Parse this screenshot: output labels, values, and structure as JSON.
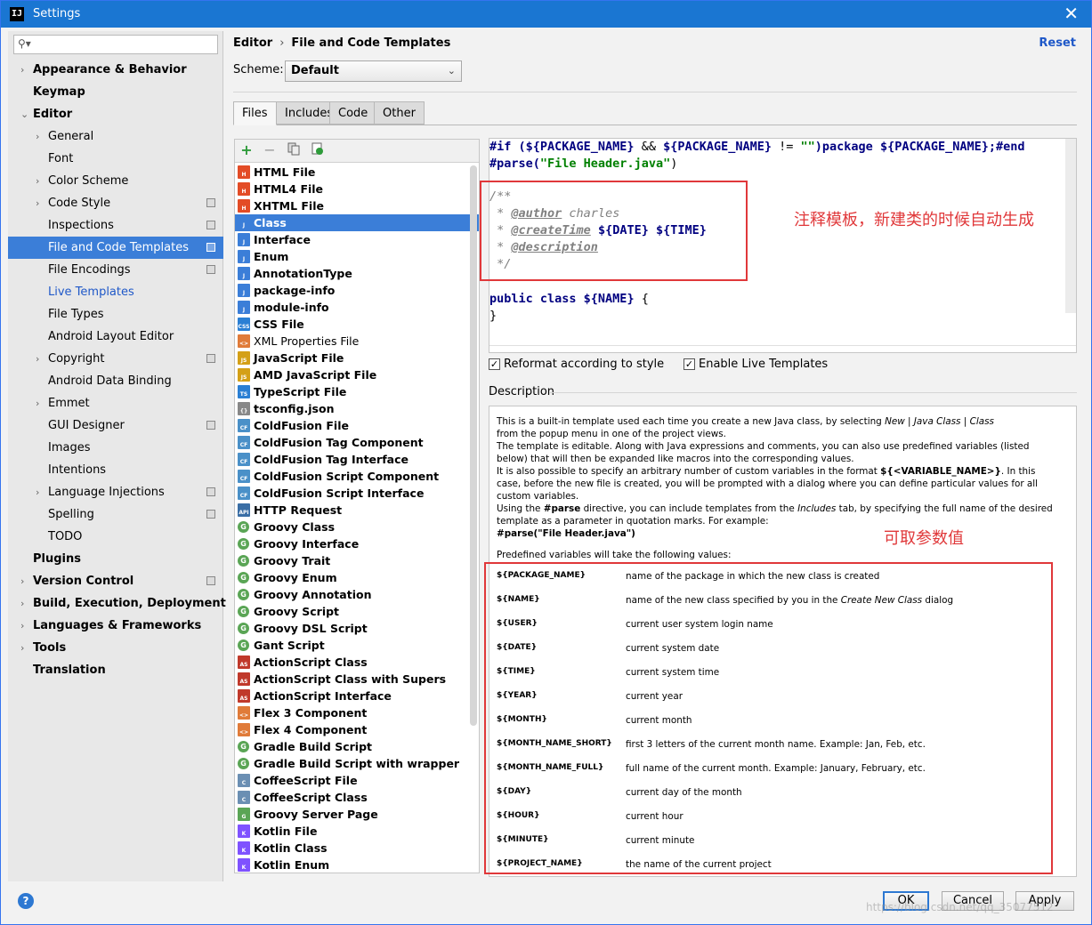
{
  "window": {
    "title": "Settings",
    "app_icon": "IJ",
    "close": "✕"
  },
  "sidebar": {
    "search_placeholder": "",
    "items": [
      {
        "label": "Appearance & Behavior",
        "level": 0,
        "bold": true,
        "arrow": true
      },
      {
        "label": "Keymap",
        "level": 0,
        "bold": true
      },
      {
        "label": "Editor",
        "level": 0,
        "bold": true,
        "arrow": true,
        "expanded": true
      },
      {
        "label": "General",
        "level": 1,
        "arrow": true
      },
      {
        "label": "Font",
        "level": 1
      },
      {
        "label": "Color Scheme",
        "level": 1,
        "arrow": true
      },
      {
        "label": "Code Style",
        "level": 1,
        "arrow": true,
        "proj": true
      },
      {
        "label": "Inspections",
        "level": 1,
        "proj": true
      },
      {
        "label": "File and Code Templates",
        "level": 1,
        "proj": true,
        "selected": true
      },
      {
        "label": "File Encodings",
        "level": 1,
        "proj": true
      },
      {
        "label": "Live Templates",
        "level": 1,
        "link": true
      },
      {
        "label": "File Types",
        "level": 1
      },
      {
        "label": "Android Layout Editor",
        "level": 1
      },
      {
        "label": "Copyright",
        "level": 1,
        "arrow": true,
        "proj": true
      },
      {
        "label": "Android Data Binding",
        "level": 1
      },
      {
        "label": "Emmet",
        "level": 1,
        "arrow": true
      },
      {
        "label": "GUI Designer",
        "level": 1,
        "proj": true
      },
      {
        "label": "Images",
        "level": 1
      },
      {
        "label": "Intentions",
        "level": 1
      },
      {
        "label": "Language Injections",
        "level": 1,
        "arrow": true,
        "proj": true
      },
      {
        "label": "Spelling",
        "level": 1,
        "proj": true
      },
      {
        "label": "TODO",
        "level": 1
      },
      {
        "label": "Plugins",
        "level": 0,
        "bold": true
      },
      {
        "label": "Version Control",
        "level": 0,
        "bold": true,
        "arrow": true,
        "proj": true
      },
      {
        "label": "Build, Execution, Deployment",
        "level": 0,
        "bold": true,
        "arrow": true
      },
      {
        "label": "Languages & Frameworks",
        "level": 0,
        "bold": true,
        "arrow": true
      },
      {
        "label": "Tools",
        "level": 0,
        "bold": true,
        "arrow": true
      },
      {
        "label": "Translation",
        "level": 0,
        "bold": true
      }
    ]
  },
  "header": {
    "crumb_1": "Editor",
    "crumb_sep": "›",
    "crumb_2": "File and Code Templates",
    "reset": "Reset",
    "scheme_label": "Scheme:",
    "scheme_value": "Default"
  },
  "tabs": [
    "Files",
    "Includes",
    "Code",
    "Other"
  ],
  "toolbar": {
    "add": "+",
    "remove": "−"
  },
  "templates": [
    {
      "label": "HTML File",
      "icon": "H",
      "color": "#e34c26"
    },
    {
      "label": "HTML4 File",
      "icon": "H",
      "color": "#e34c26"
    },
    {
      "label": "XHTML File",
      "icon": "H",
      "color": "#e34c26"
    },
    {
      "label": "Class",
      "icon": "J",
      "color": "#3b7ed8",
      "selected": true
    },
    {
      "label": "Interface",
      "icon": "J",
      "color": "#3b7ed8"
    },
    {
      "label": "Enum",
      "icon": "J",
      "color": "#3b7ed8"
    },
    {
      "label": "AnnotationType",
      "icon": "J",
      "color": "#3b7ed8"
    },
    {
      "label": "package-info",
      "icon": "J",
      "color": "#3b7ed8"
    },
    {
      "label": "module-info",
      "icon": "J",
      "color": "#3b7ed8"
    },
    {
      "label": "CSS File",
      "icon": "CSS",
      "color": "#2a7fd4"
    },
    {
      "label": "XML Properties File",
      "icon": "<>",
      "color": "#e07b39",
      "normal": true
    },
    {
      "label": "JavaScript File",
      "icon": "JS",
      "color": "#d4a017"
    },
    {
      "label": "AMD JavaScript File",
      "icon": "JS",
      "color": "#d4a017"
    },
    {
      "label": "TypeScript File",
      "icon": "TS",
      "color": "#2a7fd4"
    },
    {
      "label": "tsconfig.json",
      "icon": "{}",
      "color": "#888888"
    },
    {
      "label": "ColdFusion File",
      "icon": "CF",
      "color": "#4a90c8"
    },
    {
      "label": "ColdFusion Tag Component",
      "icon": "CF",
      "color": "#4a90c8"
    },
    {
      "label": "ColdFusion Tag Interface",
      "icon": "CF",
      "color": "#4a90c8"
    },
    {
      "label": "ColdFusion Script Component",
      "icon": "CF",
      "color": "#4a90c8"
    },
    {
      "label": "ColdFusion Script Interface",
      "icon": "CF",
      "color": "#4a90c8"
    },
    {
      "label": "HTTP Request",
      "icon": "API",
      "color": "#3a6ea5"
    },
    {
      "label": "Groovy Class",
      "icon": "G",
      "color": "#5aa555",
      "round": true
    },
    {
      "label": "Groovy Interface",
      "icon": "G",
      "color": "#5aa555",
      "round": true
    },
    {
      "label": "Groovy Trait",
      "icon": "G",
      "color": "#5aa555",
      "round": true
    },
    {
      "label": "Groovy Enum",
      "icon": "G",
      "color": "#5aa555",
      "round": true
    },
    {
      "label": "Groovy Annotation",
      "icon": "G",
      "color": "#5aa555",
      "round": true
    },
    {
      "label": "Groovy Script",
      "icon": "G",
      "color": "#5aa555",
      "round": true
    },
    {
      "label": "Groovy DSL Script",
      "icon": "G",
      "color": "#5aa555",
      "round": true
    },
    {
      "label": "Gant Script",
      "icon": "G",
      "color": "#5aa555",
      "round": true
    },
    {
      "label": "ActionScript Class",
      "icon": "AS",
      "color": "#c0392b"
    },
    {
      "label": "ActionScript Class with Supers",
      "icon": "AS",
      "color": "#c0392b"
    },
    {
      "label": "ActionScript Interface",
      "icon": "AS",
      "color": "#c0392b"
    },
    {
      "label": "Flex 3 Component",
      "icon": "<>",
      "color": "#e07b39"
    },
    {
      "label": "Flex 4 Component",
      "icon": "<>",
      "color": "#e07b39"
    },
    {
      "label": "Gradle Build Script",
      "icon": "G",
      "color": "#5aa555",
      "round": true
    },
    {
      "label": "Gradle Build Script with wrapper",
      "icon": "G",
      "color": "#5aa555",
      "round": true
    },
    {
      "label": "CoffeeScript File",
      "icon": "C",
      "color": "#6b8fb3"
    },
    {
      "label": "CoffeeScript Class",
      "icon": "C",
      "color": "#6b8fb3"
    },
    {
      "label": "Groovy Server Page",
      "icon": "G",
      "color": "#5aa555"
    },
    {
      "label": "Kotlin File",
      "icon": "K",
      "color": "#7f52ff"
    },
    {
      "label": "Kotlin Class",
      "icon": "K",
      "color": "#7f52ff"
    },
    {
      "label": "Kotlin Enum",
      "icon": "K",
      "color": "#7f52ff"
    }
  ],
  "editor": {
    "line1_a": "#if (",
    "line1_b": "${PACKAGE_NAME}",
    "line1_c": " && ",
    "line1_d": "${PACKAGE_NAME}",
    "line1_e": " != ",
    "line1_f": "\"\"",
    "line1_g": ")package ",
    "line1_h": "${PACKAGE_NAME}",
    "line1_i": ";#end",
    "line2_a": "#parse(",
    "line2_b": "\"File Header.java\"",
    "line2_c": ")",
    "c1": "/**",
    "c2_a": " * ",
    "c2_b": "@author",
    "c2_c": " charles",
    "c3_a": " * ",
    "c3_b": "@createTime",
    "c3_c": " ",
    "c3_d": "${DATE}",
    "c3_e": " ",
    "c3_f": "${TIME}",
    "c4_a": " * ",
    "c4_b": "@description",
    "c5": " */",
    "l6_a": "public class ",
    "l6_b": "${NAME}",
    "l6_c": " {",
    "l7": "}"
  },
  "annotations": {
    "template_note": "注释模板，新建类的时候自动生成",
    "vars_note": "可取参数值"
  },
  "options": {
    "reformat": "Reformat according to style",
    "live": "Enable Live Templates"
  },
  "description": {
    "label": "Description",
    "p1_a": "This is a built-in template used each time you create a new Java class, by selecting ",
    "p1_i1": "New",
    "p1_b": " | ",
    "p1_i2": "Java Class",
    "p1_c": " | ",
    "p1_i3": "Class",
    "p1_line2": "from the popup menu in one of the project views.",
    "p2": "The template is editable. Along with Java expressions and comments, you can also use predefined variables (listed below) that will then be expanded like macros into the corresponding values.",
    "p3_a": "It is also possible to specify an arbitrary number of custom variables in the format ",
    "p3_b": "${<VARIABLE_NAME>}",
    "p3_c": ". In this case, before the new file is created, you will be prompted with a dialog where you can define particular values for all custom variables.",
    "p4_a": "Using the ",
    "p4_b": "#parse",
    "p4_c": " directive, you can include templates from the ",
    "p4_i": "Includes",
    "p4_d": " tab, by specifying the full name of the desired template as a parameter in quotation marks. For example:",
    "p5": "#parse(\"File Header.java\")",
    "p6": "Predefined variables will take the following values:",
    "vars": [
      {
        "name": "${PACKAGE_NAME}",
        "desc": "name of the package in which the new class is created"
      },
      {
        "name": "${NAME}",
        "desc_a": "name of the new class specified by you in the ",
        "desc_i": "Create New Class",
        "desc_b": " dialog"
      },
      {
        "name": "${USER}",
        "desc": "current user system login name"
      },
      {
        "name": "${DATE}",
        "desc": "current system date"
      },
      {
        "name": "${TIME}",
        "desc": "current system time"
      },
      {
        "name": "${YEAR}",
        "desc": "current year"
      },
      {
        "name": "${MONTH}",
        "desc": "current month"
      },
      {
        "name": "${MONTH_NAME_SHORT}",
        "desc": "first 3 letters of the current month name. Example: Jan, Feb, etc."
      },
      {
        "name": "${MONTH_NAME_FULL}",
        "desc": "full name of the current month. Example: January, February, etc."
      },
      {
        "name": "${DAY}",
        "desc": "current day of the month"
      },
      {
        "name": "${HOUR}",
        "desc": "current hour"
      },
      {
        "name": "${MINUTE}",
        "desc": "current minute"
      },
      {
        "name": "${PROJECT_NAME}",
        "desc": "the name of the current project"
      }
    ]
  },
  "buttons": {
    "help": "?",
    "ok": "OK",
    "cancel": "Cancel",
    "apply": "Apply"
  },
  "watermark": "https://blog.csdn.net/qq_35077512",
  "colors": {
    "accent": "#3b7ed8",
    "annotation": "#e0383a",
    "link": "#1f58c8"
  }
}
